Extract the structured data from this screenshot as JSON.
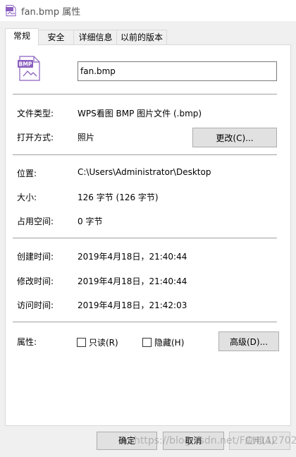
{
  "window": {
    "title": "fan.bmp 属性",
    "icon": "bmp-file-icon"
  },
  "tabs": [
    {
      "label": "常规",
      "active": true
    },
    {
      "label": "安全",
      "active": false
    },
    {
      "label": "详细信息",
      "active": false
    },
    {
      "label": "以前的版本",
      "active": false
    }
  ],
  "general": {
    "file_icon_text": "BMP",
    "filename": "fan.bmp",
    "file_type_label": "文件类型:",
    "file_type_value": "WPS看图 BMP 图片文件 (.bmp)",
    "open_with_label": "打开方式:",
    "open_with_value": "照片",
    "change_button": "更改(C)...",
    "location_label": "位置:",
    "location_value": "C:\\Users\\Administrator\\Desktop",
    "size_label": "大小:",
    "size_value": "126 字节 (126 字节)",
    "size_on_disk_label": "占用空间:",
    "size_on_disk_value": "0 字节",
    "created_label": "创建时间:",
    "created_value": "2019年4月18日，21:40:44",
    "modified_label": "修改时间:",
    "modified_value": "2019年4月18日，21:40:44",
    "accessed_label": "访问时间:",
    "accessed_value": "2019年4月18日，21:42:03",
    "attributes_label": "属性:",
    "readonly_label": "只读(R)",
    "readonly_checked": false,
    "hidden_label": "隐藏(H)",
    "hidden_checked": false,
    "advanced_button": "高级(D)..."
  },
  "footer": {
    "ok_button": "确定",
    "cancel_button": "取消",
    "apply_button": "应用(A)"
  },
  "watermark": "https://blog.csdn.net/FCH112702",
  "colors": {
    "icon_purple": "#8b5fbf",
    "panel_border": "#d9d9d9",
    "button_bg": "#e1e1e1"
  }
}
